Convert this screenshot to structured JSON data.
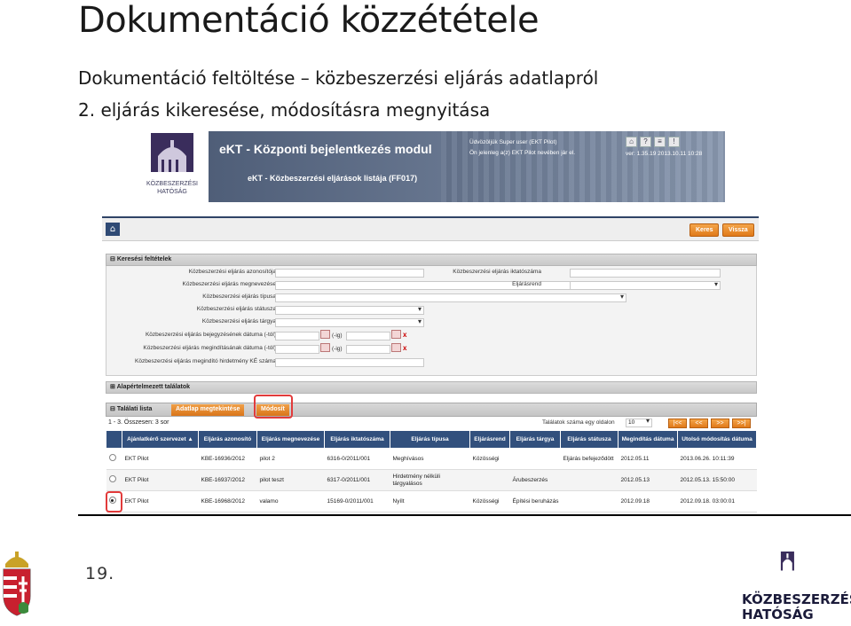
{
  "slide": {
    "title": "Dokumentáció közzététele",
    "subtitle1": "Dokumentáció feltöltése – közbeszerzési eljárás adatlapról",
    "subtitle2": "2. eljárás kikeresése, módosításra megnyitása",
    "page_number": "19.",
    "footer_logo_line1": "KÖZBESZERZÉSI",
    "footer_logo_line2": "HATÓSÁG"
  },
  "app": {
    "logo_line1": "KÖZBESZERZÉSI",
    "logo_line2": "HATÓSÁG",
    "title": "eKT - Központi bejelentkezés modul",
    "page_title": "eKT - Közbeszerzési eljárások listája (FF017)",
    "welcome": "Üdvözöljük Super user (EKT Pilot)",
    "logged_in": "Ön jelenleg a(z) EKT Pilot nevében jár el.",
    "version": "ver: 1.35.19 2013.10.11 10:28",
    "icons": [
      "home-icon",
      "help-icon",
      "print-icon",
      "alert-icon"
    ],
    "buttons": {
      "search": "Keres",
      "back": "Vissza"
    }
  },
  "search": {
    "header": "Keresési feltételek",
    "left_fields": [
      "Közbeszerzési eljárás azonosítója",
      "Közbeszerzési eljárás megnevezése",
      "Közbeszerzési eljárás típusa",
      "Közbeszerzési eljárás státusza",
      "Közbeszerzési eljárás tárgya",
      "Közbeszerzési eljárás bejegyzésének dátuma (-tól)",
      "Közbeszerzési eljárás megindításának dátuma (-tól)",
      "Közbeszerzési eljárás megindító hirdetmény KÉ száma"
    ],
    "right_fields": [
      "Közbeszerzési eljárás iktatószáma",
      "Eljárásrend"
    ],
    "to_label": "(-ig)",
    "clear_mark": "x"
  },
  "default_results": {
    "header": "Alapértelmezett találatok"
  },
  "results": {
    "header": "Találati lista",
    "tab_datasheet": "Adatlap megtekintése",
    "tab_modify": "Módosít",
    "count": "1 - 3. Összesen: 3 sor",
    "per_page_label": "Találatok száma egy oldalon",
    "per_page_value": "10",
    "pager": [
      "|<<",
      "<<",
      ">>",
      ">>|"
    ],
    "columns": [
      "",
      "Ajánlatkérő szervezet ▲",
      "Eljárás azonosító",
      "Eljárás megnevezése",
      "Eljárás iktatószáma",
      "Eljárás típusa",
      "Eljárásrend",
      "Eljárás tárgya",
      "Eljárás státusza",
      "Megindítás dátuma",
      "Utolsó módosítás dátuma"
    ],
    "rows": [
      {
        "selected": false,
        "cells": [
          "EKT Pilot",
          "KBE-16936/2012",
          "pilot 2",
          "6316-0/2011/001",
          "Meghívásos",
          "Közösségi",
          "",
          "Eljárás befejeződött",
          "2012.05.11",
          "2013.06.26. 10:11:39"
        ]
      },
      {
        "selected": false,
        "cells": [
          "EKT Pilot",
          "KBE-16937/2012",
          "pilot teszt",
          "6317-0/2011/001",
          "Hirdetmény nélküli tárgyalásos",
          "",
          "Árubeszerzés",
          "",
          "2012.05.13",
          "2012.05.13. 15:50:00"
        ]
      },
      {
        "selected": true,
        "cells": [
          "EKT Pilot",
          "KBE-16968/2012",
          "valamo",
          "15169-0/2011/001",
          "Nyílt",
          "Közösségi",
          "Építési beruházás",
          "",
          "2012.09.18",
          "2012.09.18. 03:00:01"
        ]
      }
    ]
  }
}
